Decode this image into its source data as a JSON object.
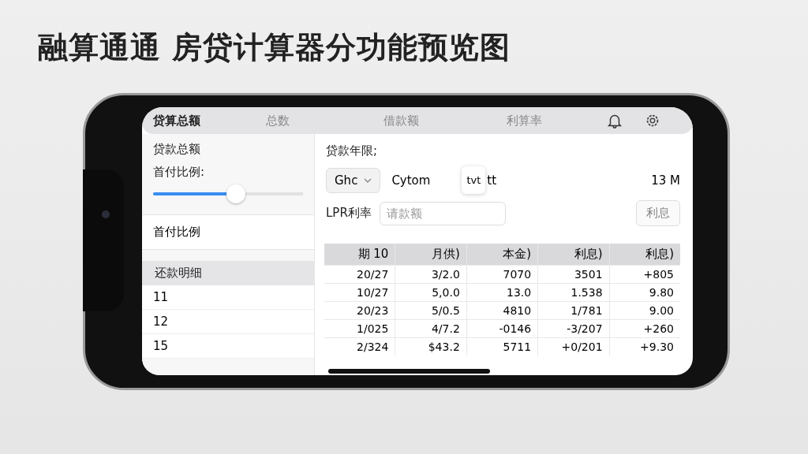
{
  "headline": "融算通通 房贷计算器分功能预览图",
  "tabs": [
    {
      "label": "贷算总额",
      "selected": true
    },
    {
      "label": "总数",
      "selected": false
    },
    {
      "label": "借款额",
      "selected": false
    },
    {
      "label": "利算率",
      "selected": false
    }
  ],
  "sidebar": {
    "amount_label": "贷款总额",
    "ratio_label": "首付比例:",
    "slider": {
      "level": 0.55
    },
    "ratio_item": "首付比例",
    "schedule_header": "还款明细",
    "schedule_items": [
      "11",
      "12",
      "15"
    ]
  },
  "term": {
    "label": "贷款年限;",
    "select": "Ghc",
    "option": "Cytom",
    "chip": "tvt",
    "chip_suffix": "tt",
    "reading": "13 M"
  },
  "rate": {
    "label": "LPR利率",
    "placeholder": "请款额",
    "button": "利息"
  },
  "table": {
    "columns": [
      "期 10",
      "月供)",
      "本金)",
      "利息)",
      "利息)"
    ],
    "rows": [
      [
        "20/27",
        "3/2.0",
        "7070",
        "3501",
        "+805"
      ],
      [
        "10/27",
        "5,0.0",
        "13.0",
        "1.538",
        "9.80"
      ],
      [
        "20/23",
        "5/0.5",
        "4810",
        "1/781",
        "9.00"
      ],
      [
        "1/025",
        "4/7.2",
        "-0146",
        "-3/207",
        "+260"
      ],
      [
        "2/324",
        "$43.2",
        "5711",
        "+0/201",
        "+9.30"
      ]
    ]
  }
}
